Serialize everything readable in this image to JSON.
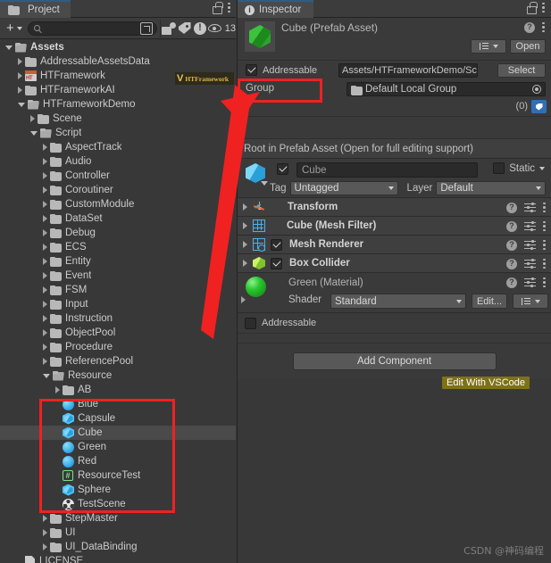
{
  "project_panel": {
    "tab_label": "Project",
    "toolbar": {
      "create_label": "+",
      "search_placeholder": "",
      "search_value": "",
      "hidden_count": "13"
    },
    "tree": [
      {
        "label": "Assets",
        "depth": 0,
        "icon": "folder-open-icon",
        "expanded": true,
        "bold": true
      },
      {
        "label": "AddressableAssetsData",
        "depth": 1,
        "icon": "folder-icon",
        "expanded": false,
        "bold": false
      },
      {
        "label": "HTFramework",
        "depth": 1,
        "icon": "ht-package-icon",
        "expanded": false,
        "bold": false
      },
      {
        "label": "HTFrameworkAI",
        "depth": 1,
        "icon": "folder-icon",
        "expanded": false,
        "bold": false
      },
      {
        "label": "HTFrameworkDemo",
        "depth": 1,
        "icon": "folder-open-icon",
        "expanded": true,
        "bold": false
      },
      {
        "label": "Scene",
        "depth": 2,
        "icon": "folder-icon",
        "expanded": false,
        "bold": false
      },
      {
        "label": "Script",
        "depth": 2,
        "icon": "folder-open-icon",
        "expanded": true,
        "bold": false
      },
      {
        "label": "AspectTrack",
        "depth": 3,
        "icon": "folder-icon",
        "expanded": false,
        "bold": false
      },
      {
        "label": "Audio",
        "depth": 3,
        "icon": "folder-icon",
        "expanded": false,
        "bold": false
      },
      {
        "label": "Controller",
        "depth": 3,
        "icon": "folder-icon",
        "expanded": false,
        "bold": false
      },
      {
        "label": "Coroutiner",
        "depth": 3,
        "icon": "folder-icon",
        "expanded": false,
        "bold": false
      },
      {
        "label": "CustomModule",
        "depth": 3,
        "icon": "folder-icon",
        "expanded": false,
        "bold": false
      },
      {
        "label": "DataSet",
        "depth": 3,
        "icon": "folder-icon",
        "expanded": false,
        "bold": false
      },
      {
        "label": "Debug",
        "depth": 3,
        "icon": "folder-icon",
        "expanded": false,
        "bold": false
      },
      {
        "label": "ECS",
        "depth": 3,
        "icon": "folder-icon",
        "expanded": false,
        "bold": false
      },
      {
        "label": "Entity",
        "depth": 3,
        "icon": "folder-icon",
        "expanded": false,
        "bold": false
      },
      {
        "label": "Event",
        "depth": 3,
        "icon": "folder-icon",
        "expanded": false,
        "bold": false
      },
      {
        "label": "FSM",
        "depth": 3,
        "icon": "folder-icon",
        "expanded": false,
        "bold": false
      },
      {
        "label": "Input",
        "depth": 3,
        "icon": "folder-icon",
        "expanded": false,
        "bold": false
      },
      {
        "label": "Instruction",
        "depth": 3,
        "icon": "folder-icon",
        "expanded": false,
        "bold": false
      },
      {
        "label": "ObjectPool",
        "depth": 3,
        "icon": "folder-icon",
        "expanded": false,
        "bold": false
      },
      {
        "label": "Procedure",
        "depth": 3,
        "icon": "folder-icon",
        "expanded": false,
        "bold": false
      },
      {
        "label": "ReferencePool",
        "depth": 3,
        "icon": "folder-icon",
        "expanded": false,
        "bold": false
      },
      {
        "label": "Resource",
        "depth": 3,
        "icon": "folder-open-icon",
        "expanded": true,
        "bold": false
      },
      {
        "label": "AB",
        "depth": 4,
        "icon": "folder-icon",
        "expanded": false,
        "bold": false
      },
      {
        "label": "Blue",
        "depth": 4,
        "icon": "material-icon",
        "expanded": null,
        "bold": false
      },
      {
        "label": "Capsule",
        "depth": 4,
        "icon": "prefab-icon",
        "expanded": null,
        "bold": false
      },
      {
        "label": "Cube",
        "depth": 4,
        "icon": "prefab-icon",
        "expanded": null,
        "bold": false,
        "selected": true
      },
      {
        "label": "Green",
        "depth": 4,
        "icon": "material-icon",
        "expanded": null,
        "bold": false
      },
      {
        "label": "Red",
        "depth": 4,
        "icon": "material-icon",
        "expanded": null,
        "bold": false
      },
      {
        "label": "ResourceTest",
        "depth": 4,
        "icon": "script-icon",
        "expanded": null,
        "bold": false
      },
      {
        "label": "Sphere",
        "depth": 4,
        "icon": "prefab-icon",
        "expanded": null,
        "bold": false
      },
      {
        "label": "TestScene",
        "depth": 4,
        "icon": "scene-icon",
        "expanded": null,
        "bold": false
      },
      {
        "label": "StepMaster",
        "depth": 3,
        "icon": "folder-icon",
        "expanded": false,
        "bold": false
      },
      {
        "label": "UI",
        "depth": 3,
        "icon": "folder-icon",
        "expanded": false,
        "bold": false
      },
      {
        "label": "UI_DataBinding",
        "depth": 3,
        "icon": "folder-icon",
        "expanded": false,
        "bold": false
      },
      {
        "label": "LICENSE",
        "depth": 1,
        "icon": "document-icon",
        "expanded": null,
        "bold": false
      }
    ],
    "watermark_logo": {
      "mark": "V",
      "text": "HTFramework"
    }
  },
  "inspector": {
    "tab_label": "Inspector",
    "prefab_title": "Cube (Prefab Asset)",
    "open_button": "Open",
    "vscode_tooltip_top": "Edit With VSCode",
    "addressable": {
      "label": "Addressable",
      "checked": true,
      "path_value": "Assets/HTFrameworkDemo/Scrip",
      "select_button": "Select"
    },
    "group": {
      "label": "Group",
      "value": "Default Local Group"
    },
    "labels": {
      "count": "(0)"
    },
    "root_notice": "Root in Prefab Asset (Open for full editing support)",
    "gameobject": {
      "enabled": true,
      "name": "Cube",
      "static_label": "Static",
      "static_checked": false,
      "tag_label": "Tag",
      "tag_value": "Untagged",
      "layer_label": "Layer",
      "layer_value": "Default"
    },
    "components": [
      {
        "name": "Transform",
        "icon": "transform-icon",
        "has_toggle": false,
        "toggle_on": false
      },
      {
        "name": "Cube (Mesh Filter)",
        "icon": "mesh-filter-icon",
        "has_toggle": false,
        "toggle_on": false
      },
      {
        "name": "Mesh Renderer",
        "icon": "mesh-renderer-icon",
        "has_toggle": true,
        "toggle_on": true
      },
      {
        "name": "Box Collider",
        "icon": "box-collider-icon",
        "has_toggle": true,
        "toggle_on": true
      }
    ],
    "material": {
      "title": "Green (Material)",
      "shader_label": "Shader",
      "shader_value": "Standard",
      "edit_button": "Edit...",
      "vscode_tooltip": "Edit With VSCode"
    },
    "addressable_bottom": {
      "label": "Addressable",
      "checked": false
    },
    "add_component_button": "Add Component"
  },
  "watermark": "CSDN @神码编程",
  "colors": {
    "panel_bg": "#383838",
    "header_bg": "#3c3c3c",
    "tab_active": "#4a4a4a",
    "accent_blue": "#2c5d87",
    "annotation_red": "#f02121",
    "tooltip_olive": "#7e7214",
    "icon_blue": "#4fc3f7",
    "material_green": "#29c62e"
  }
}
